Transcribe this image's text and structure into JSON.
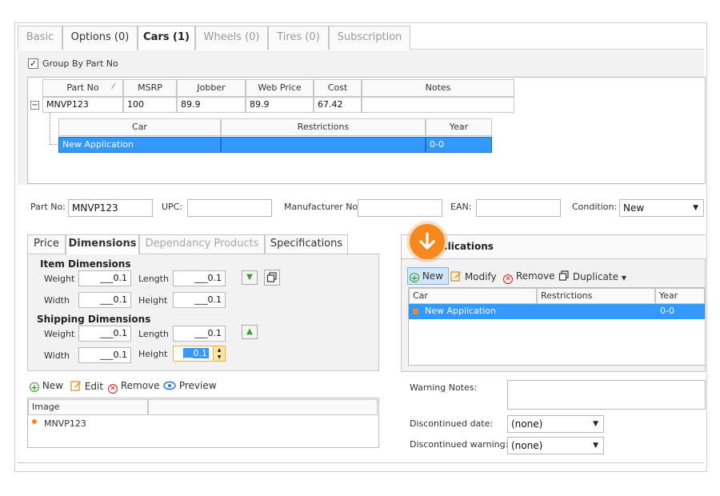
{
  "tabs": [
    {
      "label": "Basic",
      "state": "disabled"
    },
    {
      "label": "Options (0)",
      "state": "enabled"
    },
    {
      "label": "Cars (1)",
      "state": "active"
    },
    {
      "label": "Wheels (0)",
      "state": "disabled"
    },
    {
      "label": "Tires (0)",
      "state": "disabled"
    },
    {
      "label": "Subscription",
      "state": "disabled"
    }
  ],
  "group_by": {
    "label": "Group By Part No",
    "checked": "✓"
  },
  "parts_grid": {
    "headers": [
      "Part No",
      "MSRP",
      "Jobber",
      "Web Price",
      "Cost",
      "Notes"
    ],
    "sort_glyph": "⁄",
    "expand_glyph": "−",
    "row": [
      "MNVP123",
      "100",
      "89.9",
      "89.9",
      "67.42",
      ""
    ]
  },
  "cars_grid": {
    "headers": [
      "Car",
      "Restrictions",
      "Year"
    ],
    "row": [
      "New Application",
      "",
      "0-0"
    ]
  },
  "fields": {
    "part_no_label": "Part No:",
    "part_no_value": "MNVP123",
    "upc_label": "UPC:",
    "upc_value": "",
    "manufacturer_label": "Manufacturer No:",
    "manufacturer_value": "",
    "ean_label": "EAN:",
    "ean_value": "",
    "condition_label": "Condition:",
    "condition_value": "New"
  },
  "subtabs": [
    {
      "label": "Price",
      "state": "enabled"
    },
    {
      "label": "Dimensions",
      "state": "active"
    },
    {
      "label": "Dependancy Products",
      "state": "disabled"
    },
    {
      "label": "Specifications",
      "state": "enabled"
    }
  ],
  "dimensions": {
    "item_title": "Item Dimensions",
    "shipping_title": "Shipping Dimensions",
    "weight_label": "Weight",
    "length_label": "Length",
    "width_label": "Width",
    "height_label": "Height",
    "item_weight": "___0.1",
    "item_length": "___0.1",
    "item_width": "___0.1",
    "item_height": "___0.1",
    "ship_weight": "___0.1",
    "ship_length": "___0.1",
    "ship_width": "___0.1",
    "ship_height": "__0.1"
  },
  "image_toolbar": {
    "new": "New",
    "edit": "Edit",
    "remove": "Remove",
    "preview": "Preview"
  },
  "image_grid": {
    "header": "Image",
    "row": "MNVP123"
  },
  "applications": {
    "title": "...lications",
    "toolbar": {
      "new": "New",
      "modify": "Modify",
      "remove": "Remove",
      "duplicate": "Duplicate"
    },
    "headers": [
      "Car",
      "Restrictions",
      "Year"
    ],
    "row": [
      "New Application",
      "0-0"
    ]
  },
  "right_fields": {
    "warning_label": "Warning Notes:",
    "warning_value": "",
    "disc_date_label": "Discontinued date:",
    "disc_date_value": "(none)",
    "disc_warning_label": "Discontinued warning:",
    "disc_warning_value": "(none)"
  },
  "colors": {
    "selection": "#3399ff",
    "accent_orange": "#f5891f"
  }
}
